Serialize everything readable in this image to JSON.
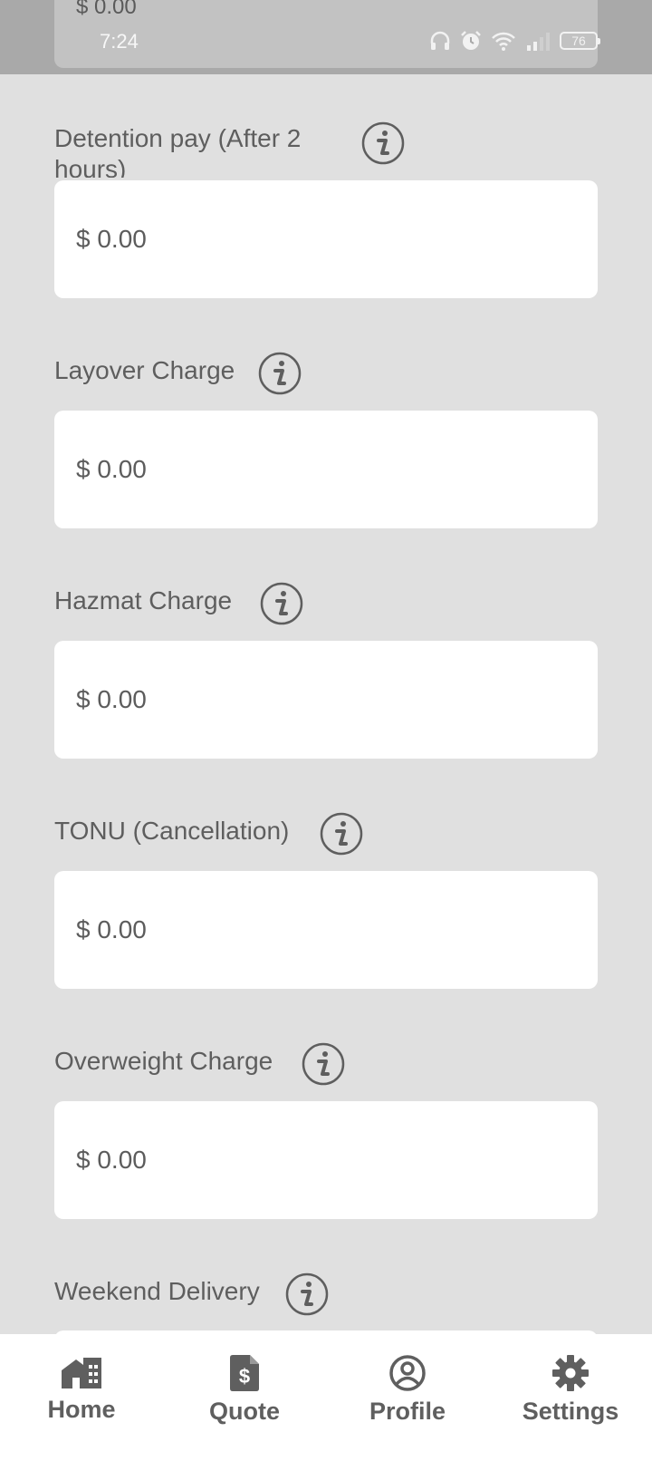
{
  "status_bar": {
    "time": "7:24",
    "battery": "76",
    "icons": [
      "headphones-icon",
      "alarm-icon",
      "wifi-icon",
      "signal-icon",
      "battery-icon"
    ]
  },
  "previous_field": {
    "value": "$ 0.00"
  },
  "charges": [
    {
      "label": "Detention pay (After 2 hours)",
      "value": "$ 0.00",
      "info_icon": "info-icon"
    },
    {
      "label": "Layover Charge",
      "value": "$ 0.00",
      "info_icon": "info-icon"
    },
    {
      "label": "Hazmat Charge",
      "value": "$ 0.00",
      "info_icon": "info-icon"
    },
    {
      "label": "TONU (Cancellation)",
      "value": "$ 0.00",
      "info_icon": "info-icon"
    },
    {
      "label": "Overweight Charge",
      "value": "$ 0.00",
      "info_icon": "info-icon"
    },
    {
      "label": "Weekend Delivery",
      "value": "",
      "info_icon": "info-icon"
    }
  ],
  "nav": [
    {
      "label": "Home",
      "icon": "home-icon"
    },
    {
      "label": "Quote",
      "icon": "quote-document-icon"
    },
    {
      "label": "Profile",
      "icon": "profile-icon"
    },
    {
      "label": "Settings",
      "icon": "gear-icon"
    }
  ],
  "colors": {
    "background": "#e0e0e0",
    "field": "#ffffff",
    "text": "#5e5e5e",
    "status_bar": "#a9a9a9"
  }
}
